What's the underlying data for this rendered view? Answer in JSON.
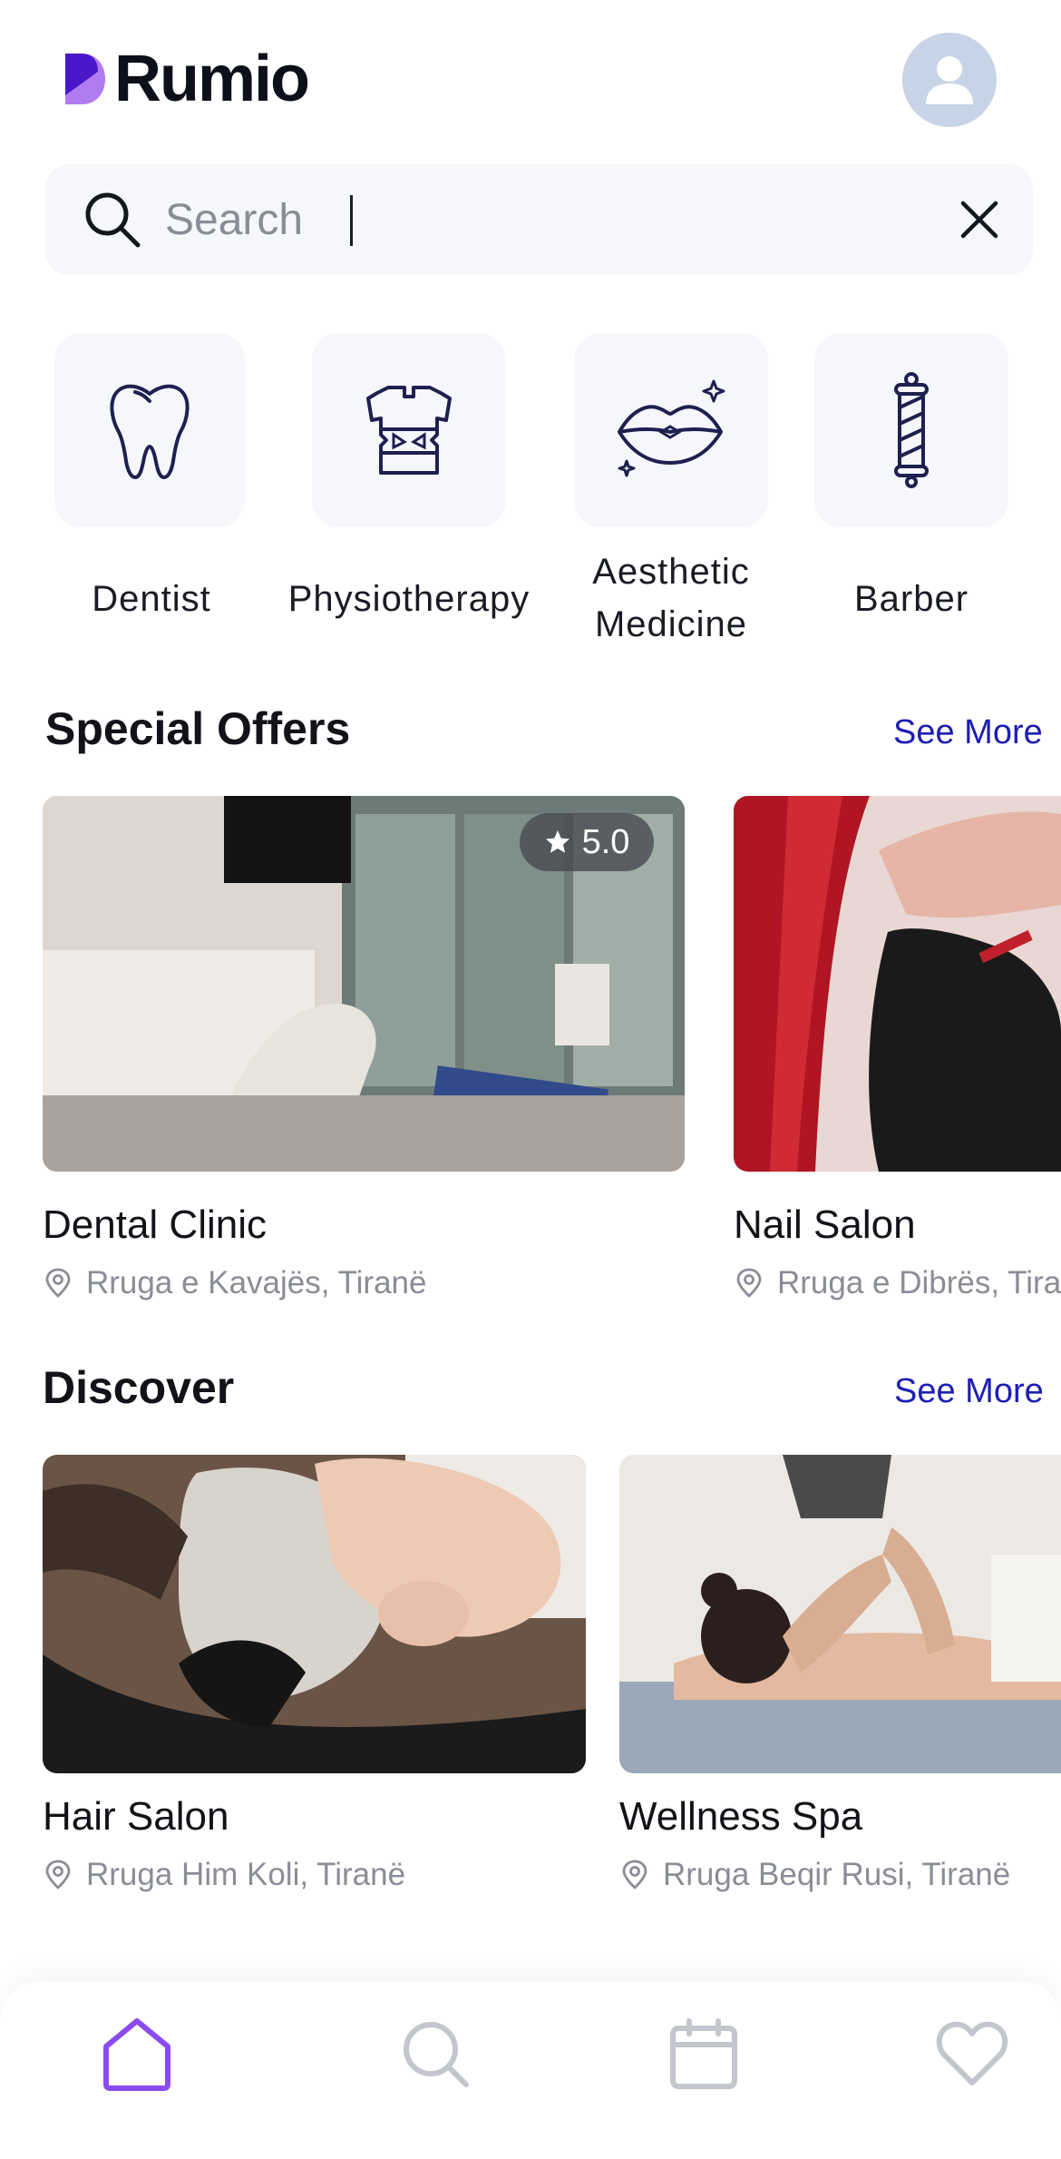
{
  "header": {
    "app_name": "Rumio"
  },
  "search": {
    "placeholder": "Search"
  },
  "categories": [
    {
      "label": "Dentist",
      "icon": "tooth-icon"
    },
    {
      "label": "Physiotherapy",
      "icon": "brace-icon"
    },
    {
      "label": "Aesthetic Medicine",
      "icon": "lips-icon"
    },
    {
      "label": "Barber",
      "icon": "barber-pole-icon"
    }
  ],
  "special_offers": {
    "title": "Special Offers",
    "see_more": "See More",
    "items": [
      {
        "name": "Dental Clinic",
        "location": "Rruga e Kavajës, Tiranë",
        "rating": "5.0"
      },
      {
        "name": "Nail Salon",
        "location": "Rruga e Dibrës, Tiranë"
      }
    ]
  },
  "discover": {
    "title": "Discover",
    "see_more": "See More",
    "items": [
      {
        "name": "Hair Salon",
        "location": "Rruga Him Koli, Tiranë"
      },
      {
        "name": "Wellness Spa",
        "location": "Rruga Beqir Rusi, Tiranë"
      }
    ]
  },
  "nav": {
    "items": [
      "home-icon",
      "search-icon",
      "calendar-icon",
      "heart-icon"
    ]
  },
  "colors": {
    "brand": "#6a2be0",
    "brand_light": "#b07cf0",
    "accent_link": "#1e1eb4",
    "nav_active": "#8a4cf0",
    "nav_inactive": "#c3c6cc"
  }
}
